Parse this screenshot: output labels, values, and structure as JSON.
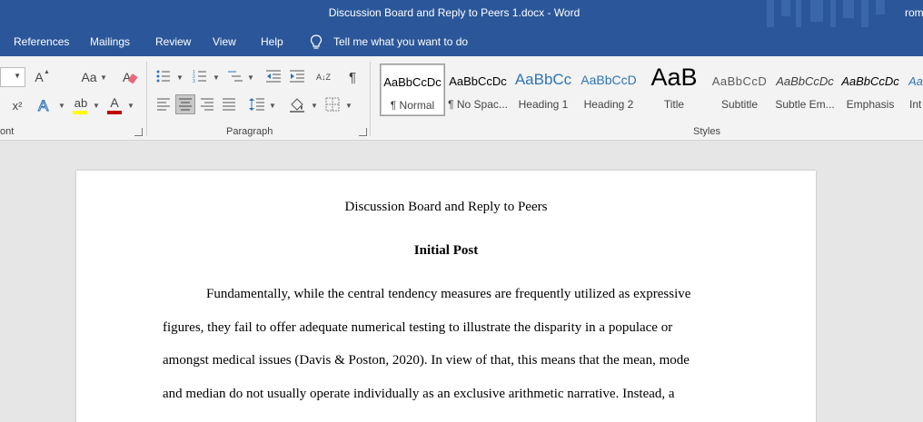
{
  "window": {
    "title": "Discussion Board and Reply to Peers 1.docx  -  Word",
    "user": "rom"
  },
  "menu": {
    "tabs": [
      "References",
      "Mailings",
      "Review",
      "View",
      "Help"
    ],
    "tell_me": "Tell me what you want to do"
  },
  "ribbon": {
    "font_group_label": "ont",
    "paragraph_group_label": "Paragraph",
    "styles_group_label": "Styles",
    "icons": {
      "grow_font": "A",
      "change_case": "Aa",
      "subscript": "x",
      "superscript": "x²",
      "text_effects": "A",
      "font_color": "A",
      "highlight": "ab",
      "sort": "A↓Z",
      "pilcrow": "¶"
    },
    "styles": [
      {
        "preview": "AaBbCcDc",
        "name": "¶ Normal"
      },
      {
        "preview": "AaBbCcDc",
        "name": "¶ No Spac..."
      },
      {
        "preview": "AaBbCc",
        "name": "Heading 1"
      },
      {
        "preview": "AaBbCcD",
        "name": "Heading 2"
      },
      {
        "preview": "AaB",
        "name": "Title"
      },
      {
        "preview": "AaBbCcD",
        "name": "Subtitle"
      },
      {
        "preview": "AaBbCcDc",
        "name": "Subtle Em..."
      },
      {
        "preview": "AaBbCcDc",
        "name": "Emphasis"
      },
      {
        "preview": "Aa",
        "name": "Int"
      }
    ],
    "colors": {
      "accent": "#2b579a",
      "font_color_bar": "#c00000",
      "highlight_bar": "#ffff00",
      "heading_blue": "#2e74b5"
    }
  },
  "document": {
    "title": "Discussion Board and Reply to Peers",
    "heading": "Initial Post",
    "lines": [
      "Fundamentally, while the central tendency measures are frequently utilized as expressive",
      "figures, they fail to offer adequate numerical testing to illustrate the disparity in a populace or",
      "amongst medical issues (Davis & Poston, 2020). In view of that, this means that the mean, mode",
      "and median do not usually operate individually as an exclusive arithmetic narrative. Instead, a"
    ]
  }
}
